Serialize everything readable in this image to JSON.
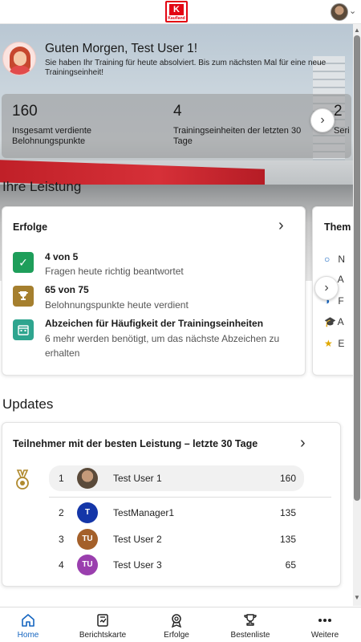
{
  "header": {
    "logo_text": "Kaufland",
    "logo_letter": "K"
  },
  "greeting": {
    "title": "Guten Morgen, Test User 1!",
    "subtitle": "Sie haben Ihr Training für heute absolviert. Bis zum nächsten Mal für eine neue Trainingseinheit!"
  },
  "stats": [
    {
      "value": "160",
      "label": "Insgesamt verdiente Belohnungspunkte"
    },
    {
      "value": "4",
      "label": "Trainingseinheiten der letzten 30 Tage"
    },
    {
      "value": "2",
      "label": "Seri"
    }
  ],
  "performance": {
    "title": "Ihre Leistung",
    "achievements_card": {
      "title": "Erfolge",
      "items": [
        {
          "title": "4 von 5",
          "subtitle": "Fragen heute richtig beantwortet",
          "icon": "check-icon",
          "color": "#1e9e5a"
        },
        {
          "title": "65 von 75",
          "subtitle": "Belohnungspunkte heute verdient",
          "icon": "trophy-icon",
          "color": "#a57f2e"
        },
        {
          "title": "Abzeichen für Häufigkeit der Trainingseinheiten",
          "subtitle": "6 mehr werden benötigt, um das nächste Abzeichen zu erhalten",
          "icon": "calendar-icon",
          "color": "#2ea58f"
        }
      ]
    },
    "topics_card": {
      "title": "Them",
      "rows": [
        "N",
        "A",
        "F",
        "A",
        "E"
      ]
    }
  },
  "updates": {
    "title": "Updates",
    "leaderboard": {
      "title": "Teilnehmer mit der besten Leistung – letzte 30 Tage",
      "rows": [
        {
          "rank": "1",
          "name": "Test User 1",
          "score": "160",
          "initials": "",
          "color": "#6b5a4a",
          "highlight": true
        },
        {
          "rank": "2",
          "name": "TestManager1",
          "score": "135",
          "initials": "T",
          "color": "#1436a8",
          "highlight": false
        },
        {
          "rank": "3",
          "name": "Test User 2",
          "score": "135",
          "initials": "TU",
          "color": "#a4602a",
          "highlight": false
        },
        {
          "rank": "4",
          "name": "Test User 3",
          "score": "65",
          "initials": "TU",
          "color": "#9a3fae",
          "highlight": false
        }
      ]
    }
  },
  "nav": [
    {
      "label": "Home",
      "icon": "home-icon",
      "active": true
    },
    {
      "label": "Berichtskarte",
      "icon": "report-card-icon",
      "active": false
    },
    {
      "label": "Erfolge",
      "icon": "achievements-icon",
      "active": false
    },
    {
      "label": "Bestenliste",
      "icon": "leaderboard-trophy-icon",
      "active": false
    },
    {
      "label": "Weitere",
      "icon": "more-icon",
      "active": false
    }
  ],
  "colors": {
    "accent": "#1565c0",
    "brand_red": "#e30613"
  }
}
